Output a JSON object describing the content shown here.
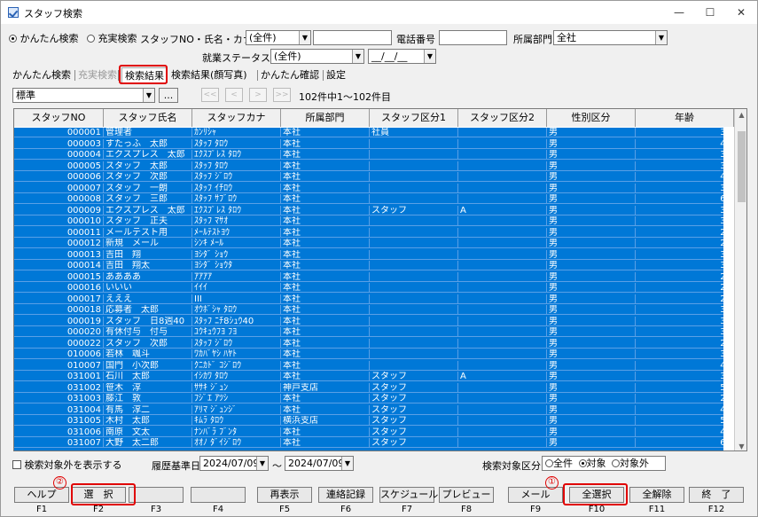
{
  "window": {
    "title": "スタッフ検索",
    "controls": [
      "—",
      "☐",
      "✕"
    ]
  },
  "search": {
    "mode_simple": "かんたん検索",
    "mode_full": "充実検索",
    "staff_label": "スタッフNO・氏名・カナ",
    "staff_select": "(全件)",
    "staff_value": "",
    "phone_label": "電話番号",
    "phone_value": "",
    "dept_label": "所属部門",
    "dept_value": "全社",
    "status_label": "就業ステータス",
    "status_value": "(全件)",
    "date_value": "__/__/__"
  },
  "tabs": [
    {
      "label": "かんたん検索"
    },
    {
      "label": "充実検索"
    },
    {
      "label": "検索結果"
    },
    {
      "label": "検索結果(顔写真)"
    },
    {
      "label": "かんたん確認"
    },
    {
      "label": "設定"
    }
  ],
  "toolbar": {
    "layout_value": "標準",
    "ellipsis": "...",
    "nav": [
      "<<",
      "<",
      ">",
      ">>"
    ],
    "count_text": "102件中1～102件目"
  },
  "grid": {
    "columns": [
      "スタッフNO",
      "スタッフ氏名",
      "スタッフカナ",
      "所属部門",
      "スタッフ区分1",
      "スタッフ区分2",
      "性別区分",
      "年齢"
    ],
    "rows": [
      [
        "000001",
        "管理者",
        "ｶﾝﾘｼｬ",
        "本社",
        "社員",
        "",
        "男",
        "37"
      ],
      [
        "000003",
        "すたっふ　太郎",
        "ｽﾀｯﾌ ﾀﾛｳ",
        "本社",
        "",
        "",
        "男",
        "49"
      ],
      [
        "000004",
        "エクスプレス　太郎",
        "ｴｸｽﾌﾟﾚｽ ﾀﾛｳ",
        "本社",
        "",
        "",
        "男",
        "34"
      ],
      [
        "000005",
        "スタッフ　太郎",
        "ｽﾀｯﾌ ﾀﾛｳ",
        "本社",
        "",
        "",
        "男",
        "34"
      ],
      [
        "000006",
        "スタッフ　次郎",
        "ｽﾀｯﾌ ｼﾞﾛｳ",
        "本社",
        "",
        "",
        "男",
        "49"
      ],
      [
        "000007",
        "スタッフ　一朗",
        "ｽﾀｯﾌ ｲﾁﾛｳ",
        "本社",
        "",
        "",
        "男",
        "33"
      ],
      [
        "000008",
        "スタッフ　三郎",
        "ｽﾀｯﾌ ｻﾌﾞﾛｳ",
        "本社",
        "",
        "",
        "男",
        "68"
      ],
      [
        "000009",
        "エクスプレス　太郎",
        "ｴｸｽﾌﾟﾚｽ ﾀﾛｳ",
        "本社",
        "スタッフ",
        "A",
        "男",
        "35"
      ],
      [
        "000010",
        "スタッフ　正夫",
        "ｽﾀｯﾌ ﾏｻｵ",
        "本社",
        "",
        "",
        "男",
        "36"
      ],
      [
        "000011",
        "メールテスト用",
        "ﾒｰﾙﾃｽﾄﾖｳ",
        "本社",
        "",
        "",
        "男",
        "24"
      ],
      [
        "000012",
        "新規　メール",
        "ｼﾝｷ ﾒｰﾙ",
        "本社",
        "",
        "",
        "男",
        "24"
      ],
      [
        "000013",
        "吉田　翔",
        "ﾖｼﾀﾞ ｼｮｳ",
        "本社",
        "",
        "",
        "男",
        "33"
      ],
      [
        "000014",
        "吉田　翔太",
        "ﾖｼﾀﾞ ｼｮｳﾀ",
        "本社",
        "",
        "",
        "男",
        "33"
      ],
      [
        "000015",
        "ああああ",
        "ｱｱｱｱ",
        "本社",
        "",
        "",
        "男",
        "23"
      ],
      [
        "000016",
        "いいい",
        "ｲｲｲ",
        "本社",
        "",
        "",
        "男",
        "23"
      ],
      [
        "000017",
        "えええ",
        "III",
        "本社",
        "",
        "",
        "男",
        "24"
      ],
      [
        "000018",
        "応募者　太郎",
        "ｵｳﾎﾞｼｬ ﾀﾛｳ",
        "本社",
        "",
        "",
        "男",
        "39"
      ],
      [
        "000019",
        "スタッフ　日8週40",
        "ｽﾀｯﾌ ﾆﾁ8ｼｭｳ40",
        "本社",
        "",
        "",
        "男",
        "33"
      ],
      [
        "000020",
        "有休付与　付与",
        "ﾕｳｷｭｳﾌﾖ ﾌﾖ",
        "本社",
        "",
        "",
        "男",
        "35"
      ],
      [
        "000022",
        "スタッフ　次郎",
        "ｽﾀｯﾌ ｼﾞﾛｳ",
        "本社",
        "",
        "",
        "男",
        "25"
      ],
      [
        "010006",
        "若林　颯斗",
        "ﾜｶﾊﾞﾔｼ ﾊﾔﾄ",
        "本社",
        "",
        "",
        "男",
        "37"
      ],
      [
        "010007",
        "国門　小次郎",
        "ｸﾆｶﾄﾞ ｺｼﾞﾛｳ",
        "本社",
        "",
        "",
        "男",
        "44"
      ],
      [
        "031001",
        "石川　太郎",
        "ｲｼｶﾜ ﾀﾛｳ",
        "本社",
        "スタッフ",
        "A",
        "男",
        "36"
      ],
      [
        "031002",
        "笹木　淳",
        "ｻｻｷ ｼﾞｭﾝ",
        "神戸支店",
        "スタッフ",
        "",
        "男",
        "51"
      ],
      [
        "031003",
        "藤江　敦",
        "ﾌｼﾞｴ ｱﾂｼ",
        "本社",
        "スタッフ",
        "",
        "男",
        "24"
      ],
      [
        "031004",
        "有馬　淳二",
        "ｱﾘﾏ ｼﾞｭﾝｼﾞ",
        "本社",
        "スタッフ",
        "",
        "男",
        "48"
      ],
      [
        "031005",
        "木村　太郎",
        "ｷﾑﾗ ﾀﾛｳ",
        "横浜支店",
        "スタッフ",
        "",
        "男",
        "59"
      ],
      [
        "031006",
        "南原　文太",
        "ﾅﾝﾊﾞﾗ ﾌﾞﾝﾀ",
        "本社",
        "スタッフ",
        "",
        "男",
        "47"
      ],
      [
        "031007",
        "大野　太二郎",
        "ｵｵﾉ ﾀﾞｲｼﾞﾛｳ",
        "本社",
        "スタッフ",
        "",
        "男",
        "69"
      ]
    ]
  },
  "footer": {
    "show_excluded_label": "検索対象外を表示する",
    "history_label": "履歴基準日",
    "date_from": "2024/07/09",
    "tilde": "～",
    "date_to": "2024/07/09",
    "target_label": "検索対象区分",
    "target_all": "全件",
    "target_on": "対象",
    "target_off": "対象外"
  },
  "fkeys": [
    {
      "label": "ヘルプ",
      "key": "F1"
    },
    {
      "label": "選　択",
      "key": "F2"
    },
    {
      "label": "",
      "key": "F3"
    },
    {
      "label": "",
      "key": "F4"
    },
    {
      "label": "再表示",
      "key": "F5"
    },
    {
      "label": "連絡記録",
      "key": "F6"
    },
    {
      "label": "スケジュール",
      "key": "F7"
    },
    {
      "label": "プレビュー",
      "key": "F8"
    },
    {
      "label": "メール",
      "key": "F9"
    },
    {
      "label": "全選択",
      "key": "F10"
    },
    {
      "label": "全解除",
      "key": "F11"
    },
    {
      "label": "終　了",
      "key": "F12"
    }
  ],
  "annotations": {
    "one": "①",
    "two": "②"
  },
  "colors": {
    "selection": "#0078d7",
    "highlight": "#e00000"
  }
}
